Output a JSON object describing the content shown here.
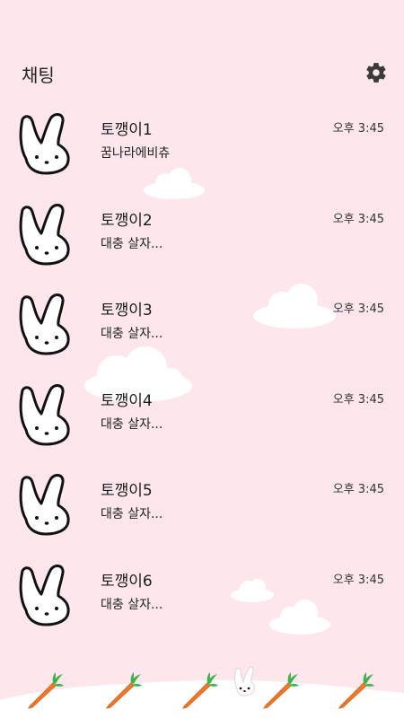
{
  "header": {
    "title": "채팅",
    "settings_icon": "gear-icon"
  },
  "colors": {
    "background": "#fde7ec",
    "carrot": "#f07a2a",
    "leaf": "#3db34a"
  },
  "chats": [
    {
      "name": "토깽이1",
      "preview": "꿈나라에비츄",
      "time": "오후 3:45",
      "avatar_icon": "bunny-icon"
    },
    {
      "name": "토깽이2",
      "preview": "대충 살자...",
      "time": "오후 3:45",
      "avatar_icon": "bunny-icon"
    },
    {
      "name": "토깽이3",
      "preview": "대충 살자...",
      "time": "오후 3:45",
      "avatar_icon": "bunny-icon"
    },
    {
      "name": "토깽이4",
      "preview": "대충 살자...",
      "time": "오후 3:45",
      "avatar_icon": "bunny-icon"
    },
    {
      "name": "토깽이5",
      "preview": "대충 살자...",
      "time": "오후 3:45",
      "avatar_icon": "bunny-icon"
    },
    {
      "name": "토깽이6",
      "preview": "대충 살자...",
      "time": "오후 3:45",
      "avatar_icon": "bunny-icon"
    }
  ],
  "footer": {
    "icons": [
      "carrot-icon",
      "carrot-icon",
      "carrot-icon",
      "bunny-icon",
      "carrot-icon",
      "carrot-icon"
    ]
  }
}
